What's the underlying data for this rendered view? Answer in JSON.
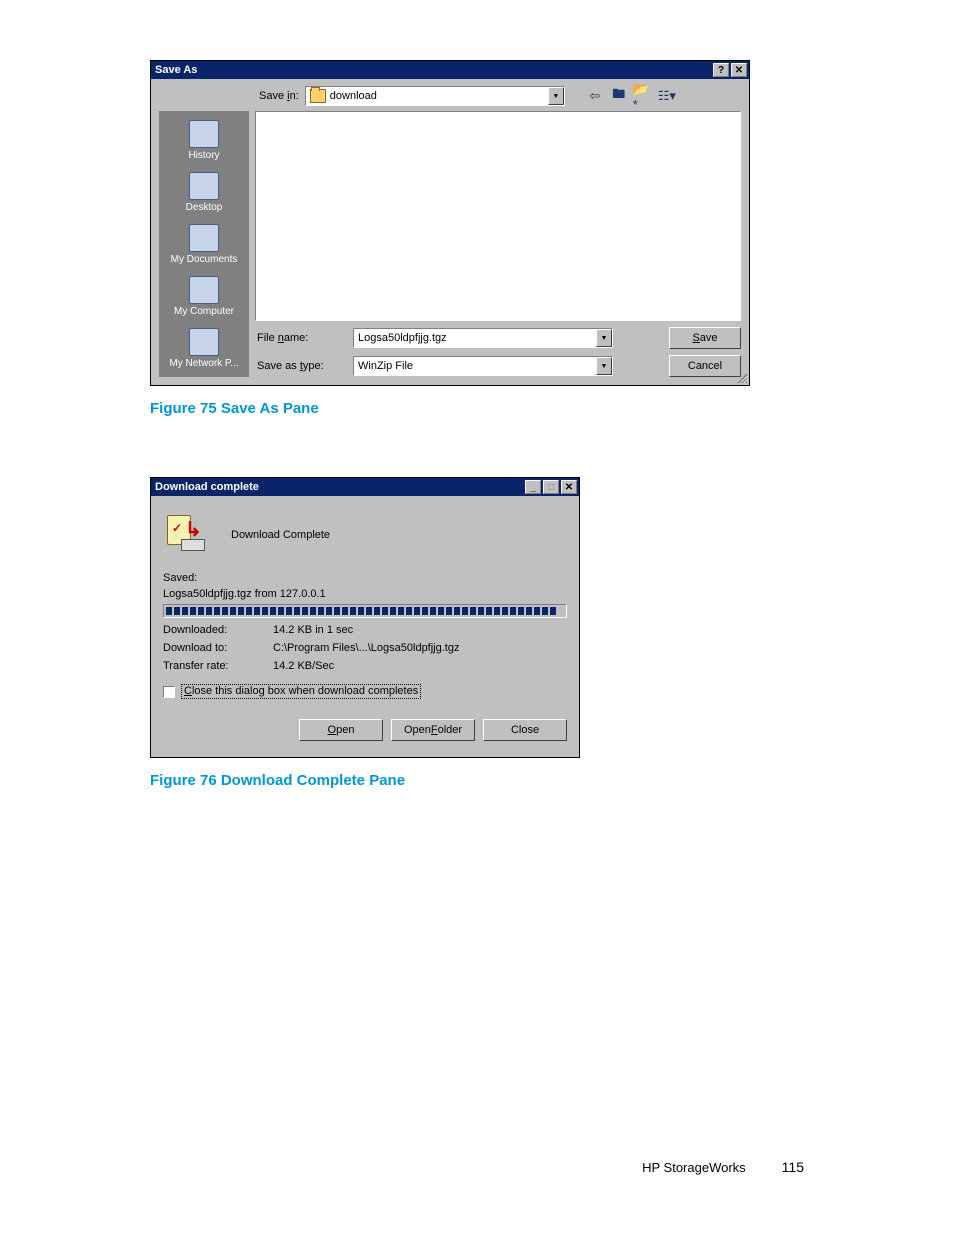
{
  "saveAs": {
    "title": "Save As",
    "saveInLabel": "Save in:",
    "saveInValue": "download",
    "places": [
      "History",
      "Desktop",
      "My Documents",
      "My Computer",
      "My Network P..."
    ],
    "fileNameLabel": "File name:",
    "fileNameValue": "Logsa50ldpfjjg.tgz",
    "saveTypeLabel": "Save as type:",
    "saveTypeValue": "WinZip File",
    "saveBtn": "Save",
    "cancelBtn": "Cancel"
  },
  "figure75": "Figure 75 Save As Pane",
  "download": {
    "title": "Download complete",
    "header": "Download Complete",
    "savedLabel": "Saved:",
    "savedLine": "Logsa50ldpfjjg.tgz from 127.0.0.1",
    "downloadedLabel": "Downloaded:",
    "downloadedValue": "14.2 KB in 1 sec",
    "downloadToLabel": "Download to:",
    "downloadToValue": "C:\\Program Files\\...\\Logsa50ldpfjjg.tgz",
    "rateLabel": "Transfer rate:",
    "rateValue": "14.2 KB/Sec",
    "closeCheck": "Close this dialog box when download completes",
    "openBtn": "Open",
    "openFolderBtn": "Open Folder",
    "closeBtn": "Close"
  },
  "figure76": "Figure 76 Download Complete Pane",
  "footer": {
    "brand": "HP StorageWorks",
    "page": "115"
  }
}
